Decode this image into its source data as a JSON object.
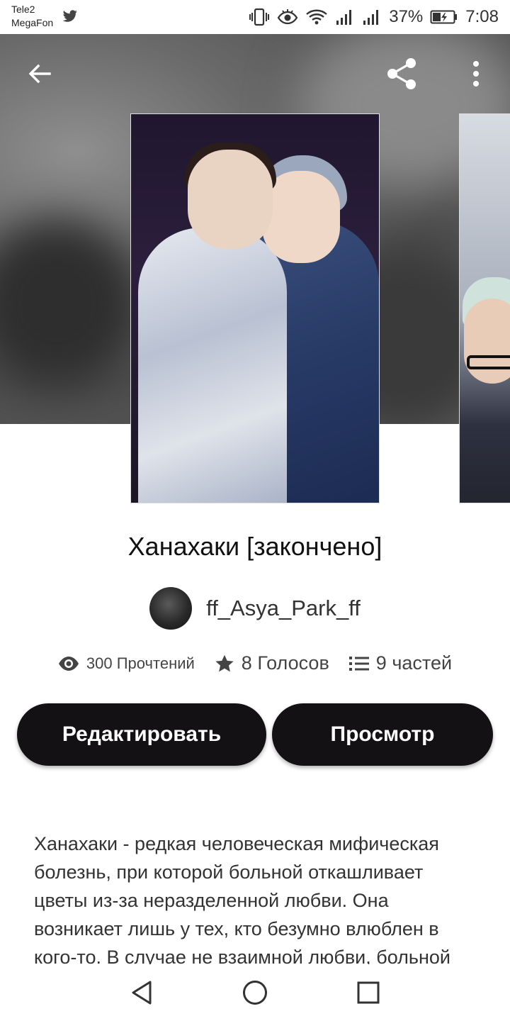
{
  "status_bar": {
    "carrier_1": "Tele2",
    "carrier_2": "MegaFon",
    "battery": "37%",
    "time": "7:08",
    "icons": [
      "twitter-icon",
      "vibrate-icon",
      "eye-comfort-icon",
      "wifi-icon",
      "signal-icon",
      "signal-icon",
      "battery-charging-icon"
    ]
  },
  "toolbar": {
    "back_icon": "arrow-left-icon",
    "share_icon": "share-icon",
    "more_icon": "more-vertical-icon"
  },
  "story": {
    "title": "Ханахаки [закончено]",
    "author": "ff_Asya_Park_ff",
    "stats": {
      "reads": "300 Прочтений",
      "votes": "8 Голосов",
      "parts": "9 частей"
    },
    "edit_label": "Редактировать",
    "view_label": "Просмотр",
    "description": "Ханахаки - редкая человеческая мифическая болезнь, при которой больной откашливает цветы из-за неразделенной любви. Она возникает лишь у тех, кто безумно влюблен в кого-то. В случае не взаимной любви, больной"
  },
  "colors": {
    "button_bg": "#131113",
    "button_text": "#ffffff",
    "text": "#333333"
  },
  "nav": {
    "icons": [
      "back-triangle-icon",
      "home-circle-icon",
      "recents-square-icon"
    ]
  }
}
